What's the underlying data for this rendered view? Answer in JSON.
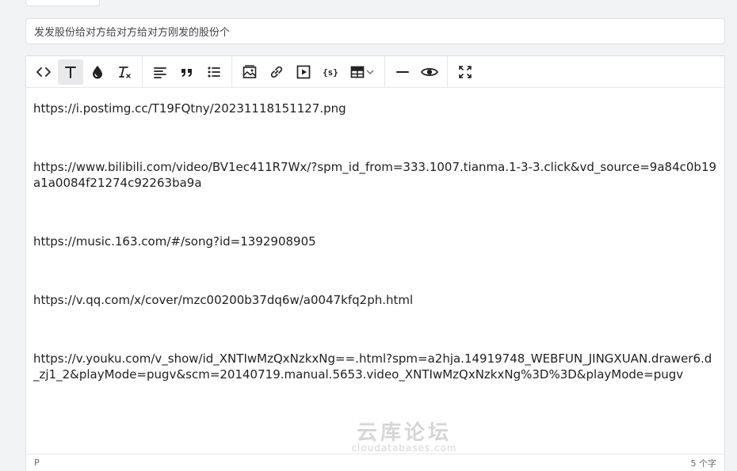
{
  "title_input": {
    "value": "发发股份给对方给对方给对方刚发的股份个"
  },
  "toolbar": {
    "icons": [
      "code-view-icon",
      "text-style-icon",
      "color-drop-icon",
      "clear-format-icon",
      "align-left-icon",
      "quote-icon",
      "bullet-list-icon",
      "image-icon",
      "link-icon",
      "video-icon",
      "code-block-icon",
      "table-icon",
      "horizontal-rule-icon",
      "preview-icon",
      "fullscreen-icon"
    ],
    "code_view": "<>",
    "text_style": "T",
    "code_block": "{s}"
  },
  "content": {
    "paragraphs": [
      "https://i.postimg.cc/T19FQtny/20231118151127.png",
      "https://www.bilibili.com/video/BV1ec411R7Wx/?spm_id_from=333.1007.tianma.1-3-3.click&vd_source=9a84c0b19a1a0084f21274c92263ba9a",
      "https://music.163.com/#/song?id=1392908905",
      "https://v.qq.com/x/cover/mzc00200b37dq6w/a0047kfq2ph.html",
      "https://v.youku.com/v_show/id_XNTIwMzQxNzkxNg==.html?spm=a2hja.14919748_WEBFUN_JINGXUAN.drawer6.d_zj1_2&playMode=pugv&scm=20140719.manual.5653.video_XNTIwMzQxNzkxNg%3D%3D&playMode=pugv"
    ]
  },
  "statusbar": {
    "element_path": "P",
    "word_count": "5 个字"
  },
  "watermark": {
    "main": "云库论坛",
    "sub": "cloudatabases.com"
  }
}
